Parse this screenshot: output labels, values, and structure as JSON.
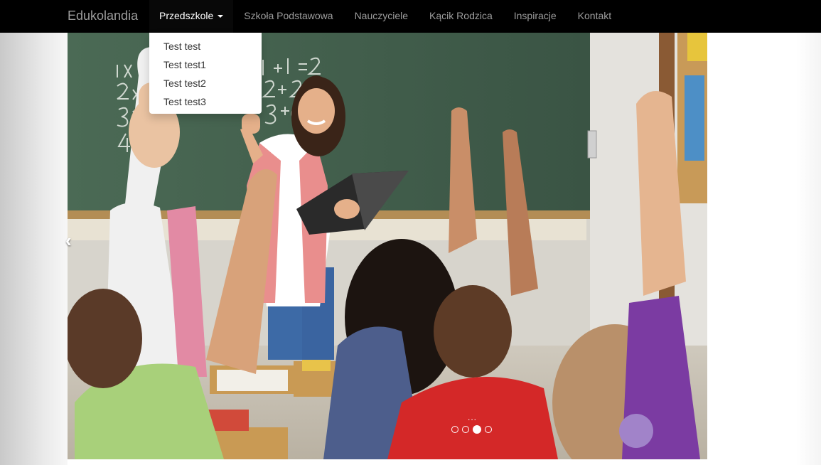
{
  "brand": "Edukolandia",
  "nav": {
    "items": [
      {
        "label": "Przedszkole"
      },
      {
        "label": "Szkoła Podstawowa"
      },
      {
        "label": "Nauczyciele"
      },
      {
        "label": "Kącik Rodzica"
      },
      {
        "label": "Inspiracje"
      },
      {
        "label": "Kontakt"
      }
    ]
  },
  "dropdown": {
    "items": [
      "Test test",
      "Test test1",
      "Test test2",
      "Test test3"
    ]
  },
  "carousel": {
    "caption": "...",
    "slide_count": 4,
    "active_index": 2,
    "prev_glyph": "‹",
    "image_alt": "classroom-photo"
  },
  "colors": {
    "navbar": "#000000",
    "nav_text": "#9d9d9d",
    "nav_active_text": "#ffffff"
  }
}
